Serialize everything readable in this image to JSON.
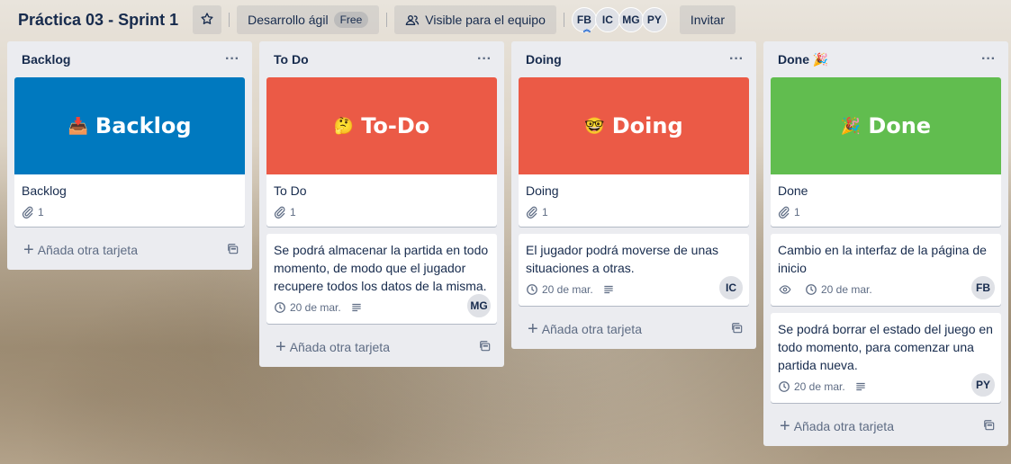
{
  "header": {
    "board_title": "Práctica 03 - Sprint 1",
    "workspace_label": "Desarrollo ágil",
    "workspace_badge": "Free",
    "visibility_label": "Visible para el equipo",
    "members": [
      "FB",
      "IC",
      "MG",
      "PY"
    ],
    "invite_label": "Invitar"
  },
  "lists": [
    {
      "title": "Backlog",
      "add_card": "Añada otra tarjeta",
      "cover_card": {
        "cover_emoji": "📥",
        "cover_text": "Backlog",
        "cover_color": "#0079bf",
        "title": "Backlog",
        "attachments": "1"
      }
    },
    {
      "title": "To Do",
      "add_card": "Añada otra tarjeta",
      "cover_card": {
        "cover_emoji": "🤔",
        "cover_text": "To-Do",
        "cover_color": "#eb5a46",
        "title": "To Do",
        "attachments": "1"
      },
      "cards": [
        {
          "title": "Se podrá almacenar la partida en todo momento, de modo que el jugador recupere todos los datos de la misma.",
          "due": "20 de mar.",
          "member": "MG"
        }
      ]
    },
    {
      "title": "Doing",
      "add_card": "Añada otra tarjeta",
      "cover_card": {
        "cover_emoji": "🤓",
        "cover_text": "Doing",
        "cover_color": "#eb5a46",
        "title": "Doing",
        "attachments": "1"
      },
      "cards": [
        {
          "title": "El jugador podrá moverse de unas situaciones a otras.",
          "due": "20 de mar.",
          "member": "IC"
        }
      ]
    },
    {
      "title": "Done 🎉",
      "add_card": "Añada otra tarjeta",
      "cover_card": {
        "cover_emoji": "🎉",
        "cover_text": "Done",
        "cover_color": "#61bd4f",
        "title": "Done",
        "attachments": "1"
      },
      "cards": [
        {
          "title": "Cambio en la interfaz de la página de inicio",
          "due": "20 de mar.",
          "member": "FB"
        },
        {
          "title": "Se podrá borrar el estado del juego en todo momento, para comenzar una partida nueva.",
          "due": "20 de mar.",
          "member": "PY"
        }
      ]
    }
  ]
}
